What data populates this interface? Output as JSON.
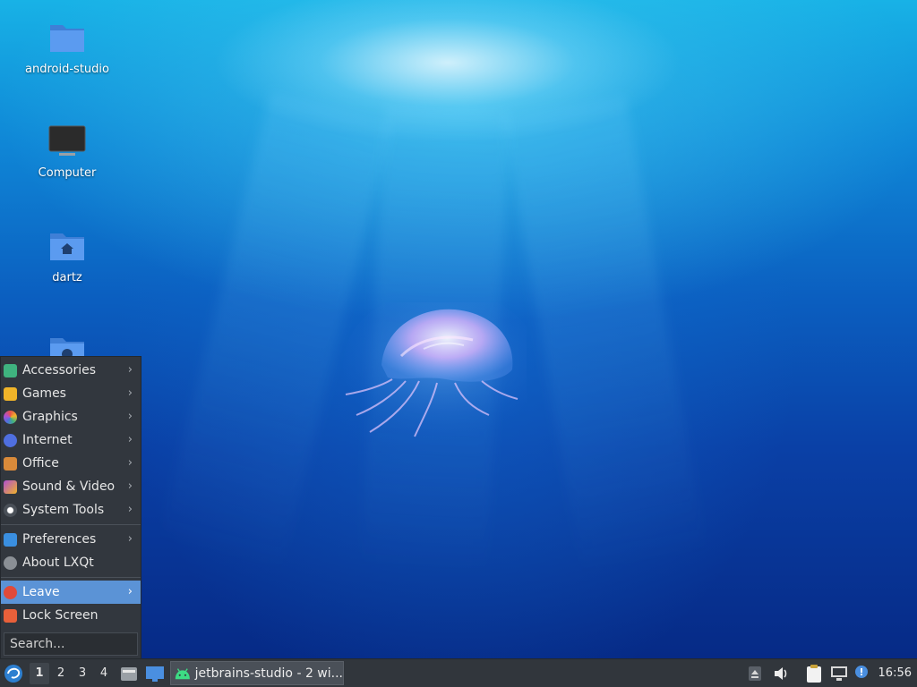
{
  "desktop": {
    "icons": [
      {
        "label": "android-studio",
        "icon": "folder-icon"
      },
      {
        "label": "Computer",
        "icon": "computer-icon"
      },
      {
        "label": "dartz",
        "icon": "home-folder-icon"
      },
      {
        "label": "",
        "icon": "network-folder-icon"
      }
    ]
  },
  "start_menu": {
    "items": [
      {
        "label": "Accessories",
        "icon": "accessories-icon",
        "color": "#3fb37f",
        "has_submenu": true
      },
      {
        "label": "Games",
        "icon": "games-icon",
        "color": "#f0b429",
        "has_submenu": true
      },
      {
        "label": "Graphics",
        "icon": "graphics-icon",
        "color": "#e8524a",
        "has_submenu": true
      },
      {
        "label": "Internet",
        "icon": "internet-icon",
        "color": "#4f6fe0",
        "has_submenu": true
      },
      {
        "label": "Office",
        "icon": "office-icon",
        "color": "#d98a3a",
        "has_submenu": true
      },
      {
        "label": "Sound & Video",
        "icon": "sound-video-icon",
        "color": "#b04fd0",
        "has_submenu": true
      },
      {
        "label": "System Tools",
        "icon": "system-tools-icon",
        "color": "#dcdcdc",
        "has_submenu": true
      },
      {
        "label": "Preferences",
        "icon": "preferences-icon",
        "color": "#3a8fe0",
        "has_submenu": true
      },
      {
        "label": "About LXQt",
        "icon": "about-icon",
        "color": "#8a8f95",
        "has_submenu": false
      },
      {
        "label": "Leave",
        "icon": "power-icon",
        "color": "#e04a3a",
        "has_submenu": true,
        "highlighted": true
      },
      {
        "label": "Lock Screen",
        "icon": "lock-icon",
        "color": "#e8603a",
        "has_submenu": false
      }
    ],
    "search_placeholder": "Search..."
  },
  "taskbar": {
    "start_icon": "lxqt-logo-icon",
    "workspaces": [
      "1",
      "2",
      "3",
      "4"
    ],
    "current_workspace": "1",
    "quicklaunch": [
      {
        "icon": "file-manager-icon"
      },
      {
        "icon": "show-desktop-icon"
      }
    ],
    "task": {
      "label": "jetbrains-studio - 2 wi...",
      "icon": "android-icon"
    },
    "tray": [
      {
        "icon": "eject-icon"
      },
      {
        "icon": "volume-icon"
      },
      {
        "icon": "clipboard-icon"
      },
      {
        "icon": "network-icon"
      },
      {
        "icon": "notification-icon"
      }
    ],
    "clock": "16:56"
  },
  "colors": {
    "accent": "#5b93d6",
    "panel": "#31363c",
    "menu_bg": "#32373e"
  }
}
